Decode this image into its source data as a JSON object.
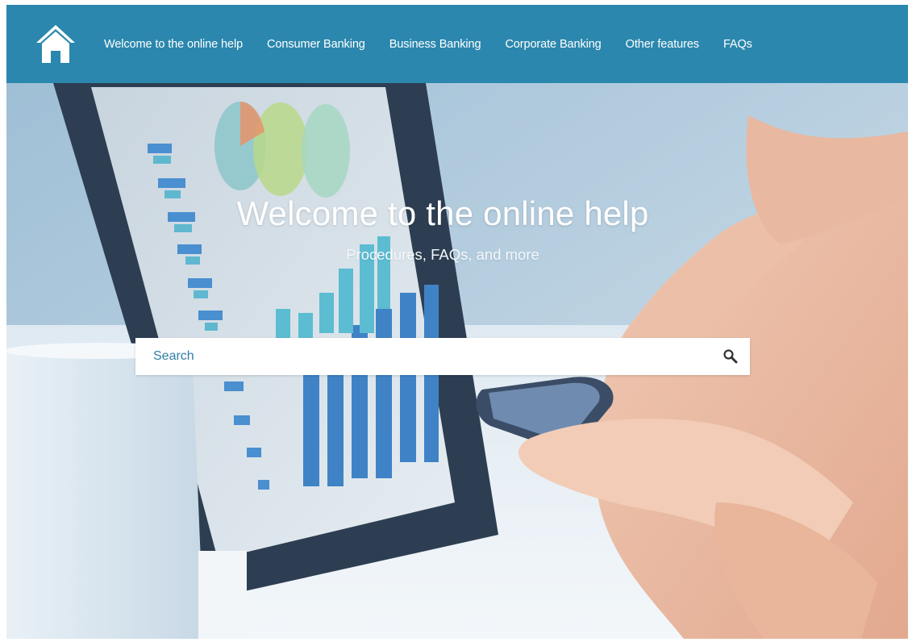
{
  "nav": {
    "home_icon": "house-icon",
    "items": [
      {
        "label": "Welcome to the online help"
      },
      {
        "label": "Consumer Banking"
      },
      {
        "label": "Business Banking"
      },
      {
        "label": "Corporate Banking"
      },
      {
        "label": "Other features"
      },
      {
        "label": "FAQs"
      }
    ]
  },
  "hero": {
    "title": "Welcome to the online help",
    "subtitle": "Procedures, FAQs, and more"
  },
  "search": {
    "placeholder": "Search",
    "icon": "magnifier-icon"
  },
  "colors": {
    "nav_bg": "#2b87ad",
    "accent_text": "#2f7fa6"
  }
}
